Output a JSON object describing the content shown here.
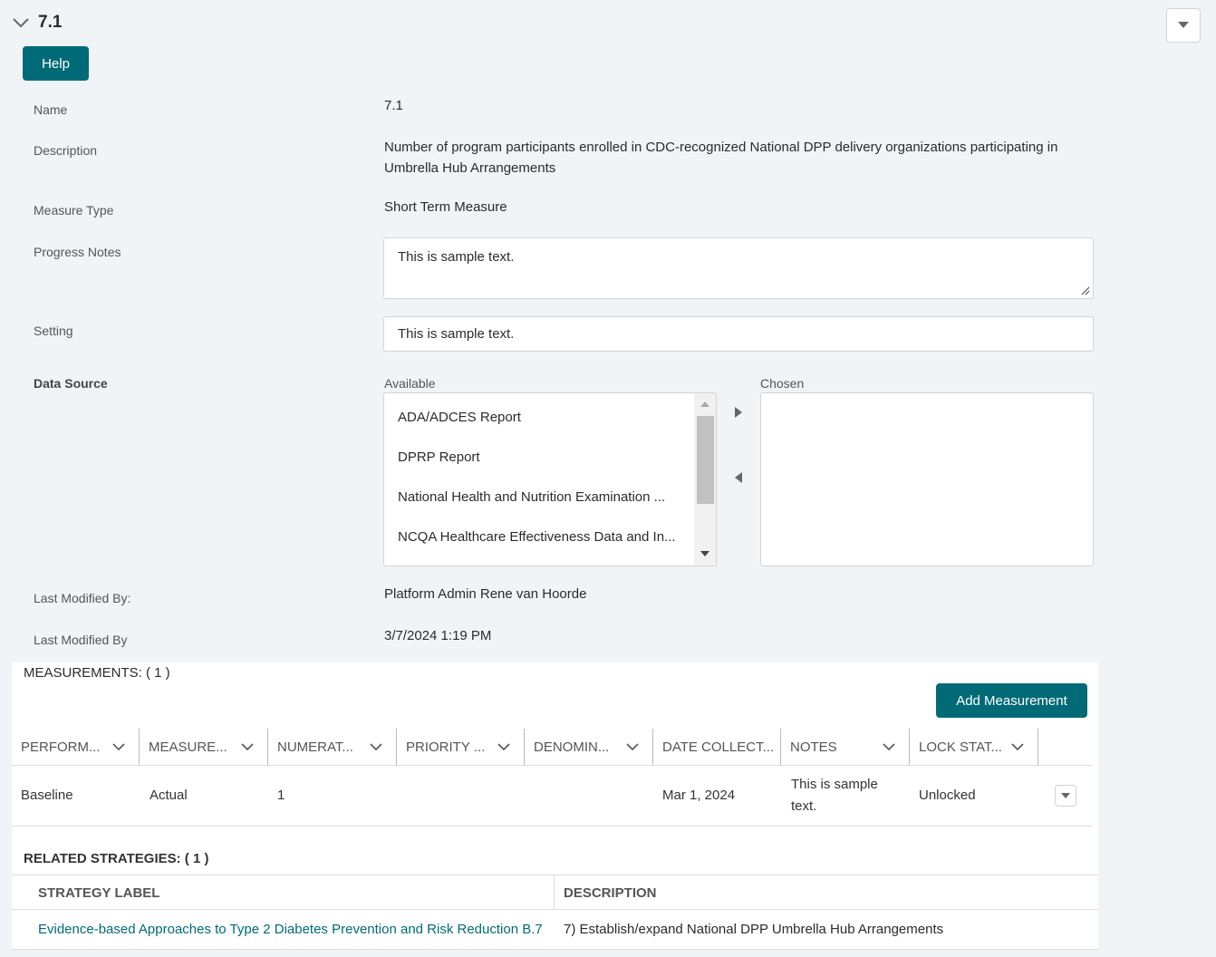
{
  "header": {
    "title": "7.1",
    "help_label": "Help"
  },
  "fields": {
    "name_label": "Name",
    "name_value": "7.1",
    "description_label": "Description",
    "description_value": "Number of program participants enrolled in CDC-recognized National DPP delivery organizations participating in Umbrella Hub Arrangements",
    "measure_type_label": "Measure Type",
    "measure_type_value": "Short Term Measure",
    "progress_notes_label": "Progress Notes",
    "progress_notes_value": "This is sample text.",
    "setting_label": "Setting",
    "setting_value": "This is sample text.",
    "data_source_label": "Data Source",
    "available_label": "Available",
    "chosen_label": "Chosen",
    "available_options": [
      "ADA/ADCES Report",
      "DPRP Report",
      "National Health and Nutrition Examination ...",
      "NCQA Healthcare Effectiveness Data and In..."
    ],
    "last_modified_by_label": "Last Modified By:",
    "last_modified_by_value": "Platform Admin Rene van Hoorde",
    "last_modified_label": "Last Modified By",
    "last_modified_value": "3/7/2024 1:19 PM"
  },
  "measurements": {
    "title": "MEASUREMENTS: ( 1 )",
    "add_label": "Add Measurement",
    "columns": [
      "PERFORM...",
      "MEASURE...",
      "NUMERAT...",
      "PRIORITY ...",
      "DENOMIN...",
      "DATE COLLECT...",
      "NOTES",
      "LOCK STAT..."
    ],
    "rows": [
      [
        "Baseline",
        "Actual",
        "1",
        "",
        "",
        "Mar 1, 2024",
        "This is sample text.",
        "Unlocked"
      ]
    ]
  },
  "strategies": {
    "title": "RELATED STRATEGIES: ( 1 )",
    "columns": [
      "STRATEGY LABEL",
      "DESCRIPTION"
    ],
    "rows": [
      [
        "Evidence-based Approaches to Type 2 Diabetes Prevention and Risk Reduction B.7",
        "7) Establish/expand National DPP Umbrella Hub Arrangements"
      ]
    ]
  },
  "colors": {
    "accent": "#006b77",
    "link": "#006b77",
    "background": "#f0f4f7"
  }
}
